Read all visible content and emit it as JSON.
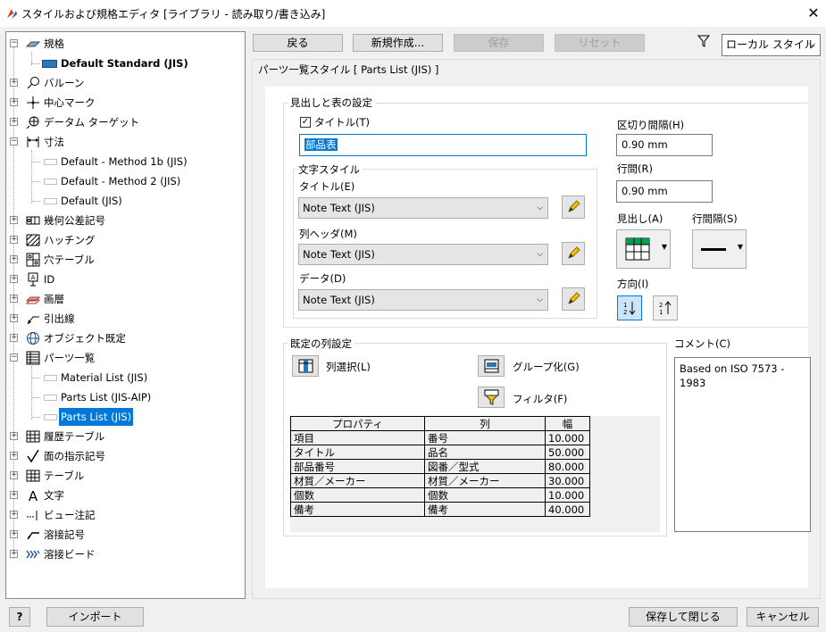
{
  "window": {
    "title": "スタイルおよび規格エディタ [ライブラリ - 読み取り/書き込み]",
    "close": "✕"
  },
  "tree": {
    "items": [
      {
        "label": "規格",
        "bold": false
      },
      {
        "label": "Default Standard (JIS)",
        "bold": true
      },
      {
        "label": "バルーン"
      },
      {
        "label": "中心マーク"
      },
      {
        "label": "データム ターゲット"
      },
      {
        "label": "寸法"
      },
      {
        "label": "Default - Method 1b (JIS)"
      },
      {
        "label": "Default - Method 2 (JIS)"
      },
      {
        "label": "Default (JIS)"
      },
      {
        "label": "幾何公差記号"
      },
      {
        "label": "ハッチング"
      },
      {
        "label": "穴テーブル"
      },
      {
        "label": "ID"
      },
      {
        "label": "画層"
      },
      {
        "label": "引出線"
      },
      {
        "label": "オブジェクト既定"
      },
      {
        "label": "パーツ一覧"
      },
      {
        "label": "Material List (JIS)"
      },
      {
        "label": "Parts List (JIS-AIP)"
      },
      {
        "label": "Parts List (JIS)"
      },
      {
        "label": "履歴テーブル"
      },
      {
        "label": "面の指示記号"
      },
      {
        "label": "テーブル"
      },
      {
        "label": "文字"
      },
      {
        "label": "ビュー注記"
      },
      {
        "label": "溶接記号"
      },
      {
        "label": "溶接ビード"
      }
    ]
  },
  "toolbar": {
    "back": "戻る",
    "new": "新規作成...",
    "save": "保存",
    "reset": "リセット",
    "filter_value": "ローカル スタイル"
  },
  "panel": {
    "heading": "パーツ一覧スタイル [ Parts List (JIS) ]"
  },
  "heading_group": {
    "label": "見出しと表の設定",
    "title_checkbox": "タイトル(T)",
    "title_value": "部品表"
  },
  "text_style": {
    "label": "文字スタイル",
    "title_label": "タイトル(E)",
    "title_value": "Note Text (JIS)",
    "header_label": "列ヘッダ(M)",
    "header_value": "Note Text (JIS)",
    "data_label": "データ(D)",
    "data_value": "Note Text (JIS)"
  },
  "spacing": {
    "line_space_label": "区切り間隔(H)",
    "line_space_value": "0.90 mm",
    "row_space_label": "行間(R)",
    "row_space_value": "0.90 mm",
    "heading_label": "見出し(A)",
    "row_gap_label": "行間隔(S)",
    "direction_label": "方向(I)"
  },
  "columns": {
    "label": "既定の列設定",
    "select_button": "列選択(L)",
    "group_button": "グループ化(G)",
    "filter_button": "フィルタ(F)",
    "headers": [
      "プロパティ",
      "列",
      "幅"
    ],
    "rows": [
      [
        "項目",
        "番号",
        "10.000"
      ],
      [
        "タイトル",
        "品名",
        "50.000"
      ],
      [
        "部品番号",
        "図番／型式",
        "80.000"
      ],
      [
        "材質／メーカー",
        "材質／メーカー",
        "30.000"
      ],
      [
        "個数",
        "個数",
        "10.000"
      ],
      [
        "備考",
        "備考",
        "40.000"
      ]
    ]
  },
  "comment": {
    "label": "コメント(C)",
    "text": "Based on ISO 7573 - 1983"
  },
  "footer": {
    "help": "?",
    "import": "インポート",
    "save_close": "保存して閉じる",
    "cancel": "キャンセル"
  },
  "colors": {
    "accent": "#0078d7",
    "panel": "#f0f0f0"
  }
}
